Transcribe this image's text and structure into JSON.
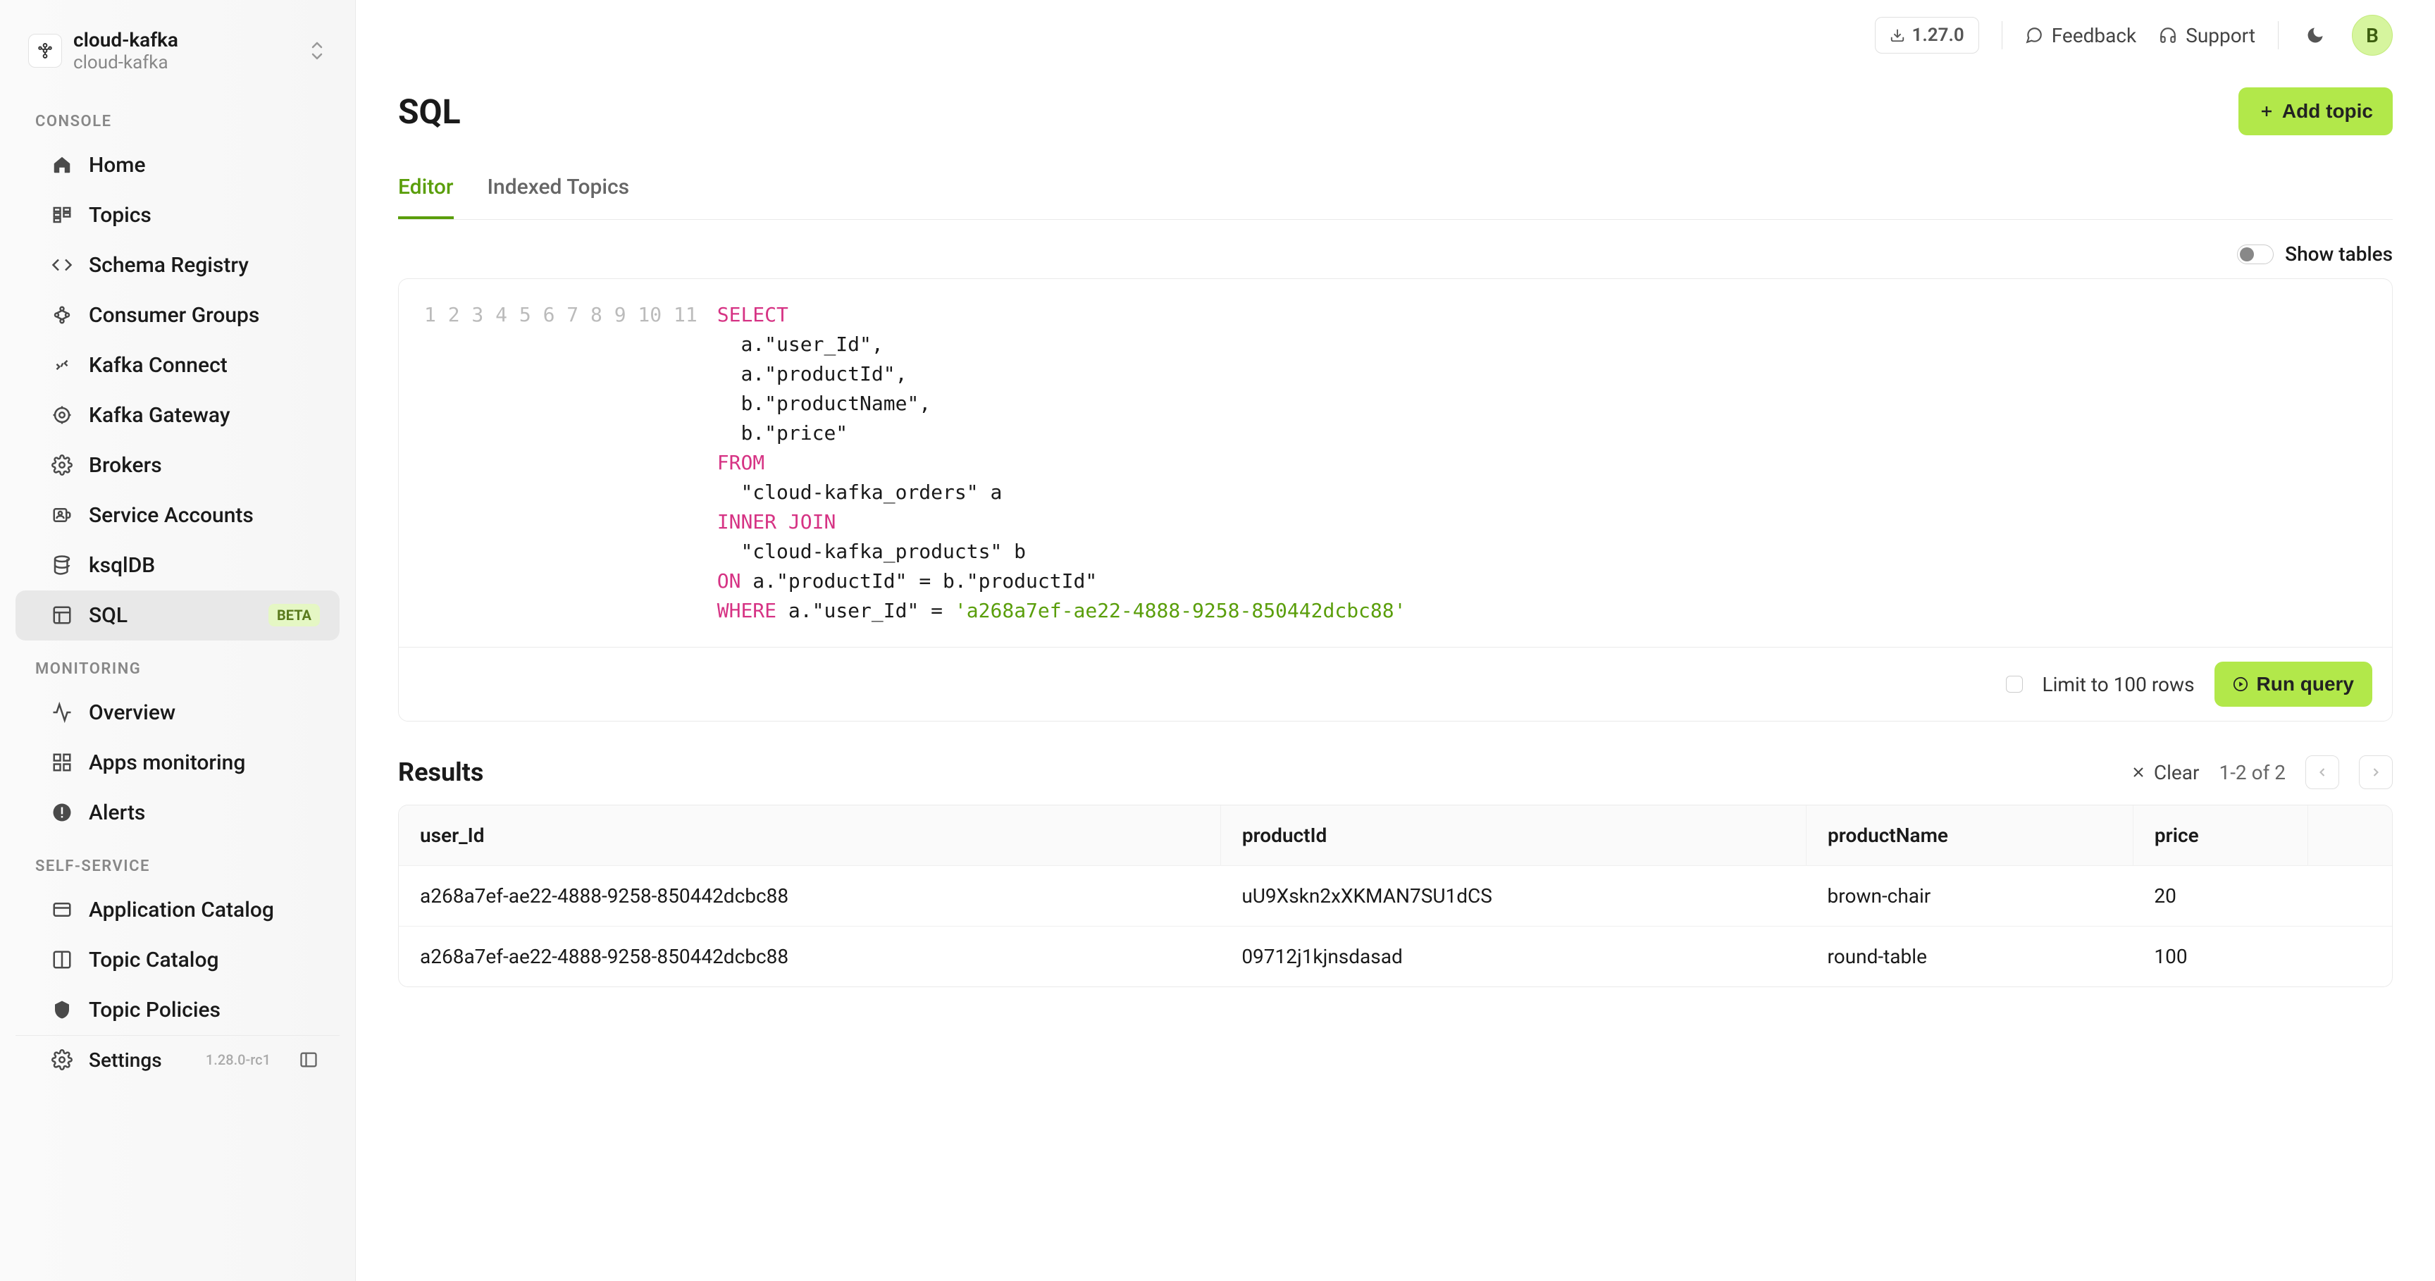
{
  "sidebar": {
    "cluster": {
      "name": "cloud-kafka",
      "sub": "cloud-kafka"
    },
    "sections": [
      {
        "title": "CONSOLE",
        "items": [
          {
            "label": "Home",
            "icon": "home-icon"
          },
          {
            "label": "Topics",
            "icon": "topics-icon"
          },
          {
            "label": "Schema Registry",
            "icon": "schema-icon"
          },
          {
            "label": "Consumer Groups",
            "icon": "groups-icon"
          },
          {
            "label": "Kafka Connect",
            "icon": "connect-icon"
          },
          {
            "label": "Kafka Gateway",
            "icon": "gateway-icon"
          },
          {
            "label": "Brokers",
            "icon": "brokers-icon"
          },
          {
            "label": "Service Accounts",
            "icon": "accounts-icon"
          },
          {
            "label": "ksqlDB",
            "icon": "ksqldb-icon"
          },
          {
            "label": "SQL",
            "icon": "sql-icon",
            "badge": "BETA",
            "active": true
          }
        ]
      },
      {
        "title": "MONITORING",
        "items": [
          {
            "label": "Overview",
            "icon": "overview-icon"
          },
          {
            "label": "Apps monitoring",
            "icon": "apps-icon"
          },
          {
            "label": "Alerts",
            "icon": "alerts-icon"
          }
        ]
      },
      {
        "title": "SELF-SERVICE",
        "items": [
          {
            "label": "Application Catalog",
            "icon": "appcat-icon"
          },
          {
            "label": "Topic Catalog",
            "icon": "topiccat-icon"
          },
          {
            "label": "Topic Policies",
            "icon": "policies-icon"
          }
        ]
      }
    ],
    "footer": {
      "label": "Settings",
      "version": "1.28.0-rc1"
    }
  },
  "topbar": {
    "version": "1.27.0",
    "feedback": "Feedback",
    "support": "Support",
    "avatarInitial": "B"
  },
  "page": {
    "title": "SQL",
    "addTopic": "Add topic",
    "tabs": [
      {
        "label": "Editor",
        "active": true
      },
      {
        "label": "Indexed Topics",
        "active": false
      }
    ],
    "showTablesLabel": "Show tables"
  },
  "editor": {
    "lines": 11,
    "sql": "SELECT\n  a.\"user_Id\",\n  a.\"productId\",\n  b.\"productName\",\n  b.\"price\"\nFROM\n  \"cloud-kafka_orders\" a\nINNER JOIN\n  \"cloud-kafka_products\" b\nON a.\"productId\" = b.\"productId\"\nWHERE a.\"user_Id\" = 'a268a7ef-ae22-4888-9258-850442dcbc88'",
    "limitLabel": "Limit to 100 rows",
    "runLabel": "Run query"
  },
  "results": {
    "title": "Results",
    "clearLabel": "Clear",
    "pager": "1-2 of 2",
    "columns": [
      "user_Id",
      "productId",
      "productName",
      "price"
    ],
    "rows": [
      [
        "a268a7ef-ae22-4888-9258-850442dcbc88",
        "uU9Xskn2xXKMAN7SU1dCS",
        "brown-chair",
        "20"
      ],
      [
        "a268a7ef-ae22-4888-9258-850442dcbc88",
        "09712j1kjnsdasad",
        "round-table",
        "100"
      ]
    ]
  }
}
